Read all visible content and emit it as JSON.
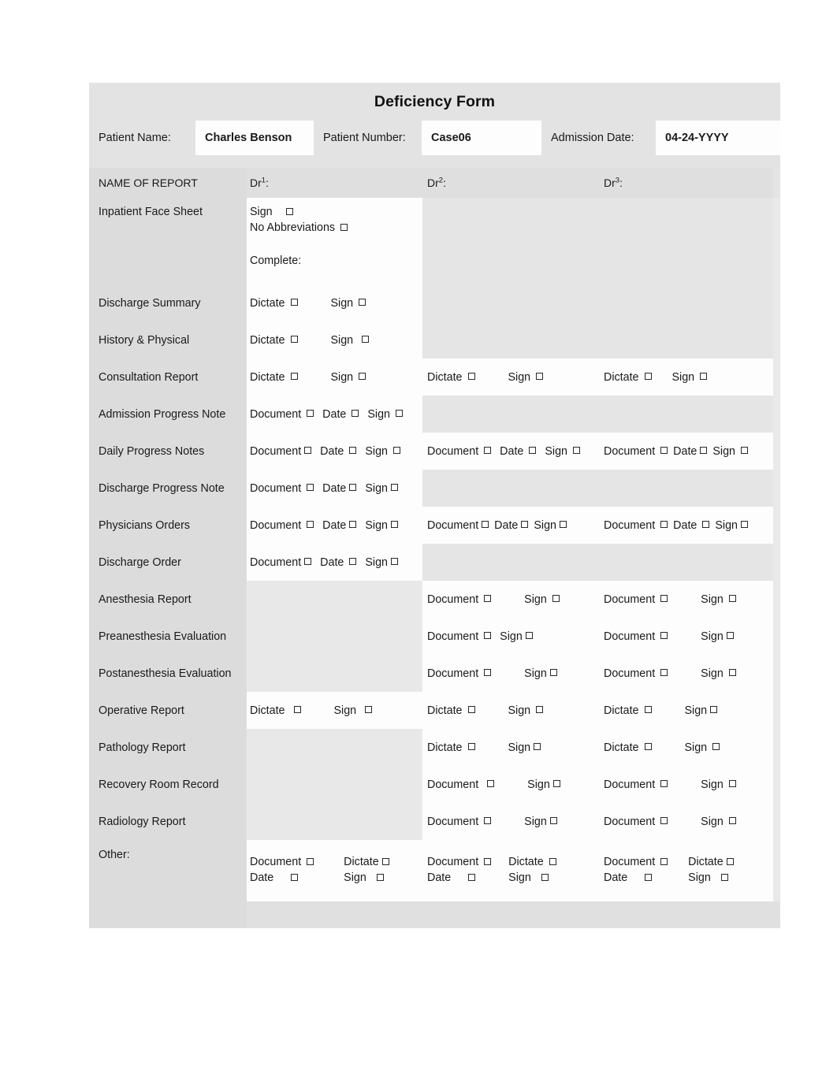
{
  "form": {
    "title": "Deficiency Form",
    "patient": {
      "name_label": "Patient Name:",
      "name_value": "Charles Benson",
      "number_label": "Patient Number:",
      "number_value": "Case06",
      "admission_label": "Admission Date:",
      "admission_value": "04-24-YYYY"
    },
    "columns": {
      "report_header": "NAME OF REPORT",
      "dr1_header": "Dr",
      "dr1_sup": "1",
      "dr1_colon": ":",
      "dr2_header": "Dr",
      "dr2_sup": "2",
      "dr2_colon": ":",
      "dr3_header": "Dr",
      "dr3_sup": "3",
      "dr3_colon": ":"
    },
    "labels": {
      "sign": "Sign",
      "dictate": "Dictate",
      "document": "Document",
      "date": "Date",
      "no_abbreviations": "No Abbreviations",
      "complete": "Complete:"
    },
    "rows": [
      {
        "name": "Inpatient Face Sheet",
        "dr1": [
          "Sign",
          "No Abbreviations",
          "Complete:"
        ],
        "dr2": [],
        "dr3": []
      },
      {
        "name": "Discharge Summary",
        "dr1": [
          "Dictate",
          "Sign"
        ],
        "dr2": [],
        "dr3": []
      },
      {
        "name": "History & Physical",
        "dr1": [
          "Dictate",
          "Sign"
        ],
        "dr2": [],
        "dr3": []
      },
      {
        "name": "Consultation Report",
        "dr1": [
          "Dictate",
          "Sign"
        ],
        "dr2": [
          "Dictate",
          "Sign"
        ],
        "dr3": [
          "Dictate",
          "Sign"
        ]
      },
      {
        "name": "Admission Progress Note",
        "dr1": [
          "Document",
          "Date",
          "Sign"
        ],
        "dr2": [],
        "dr3": []
      },
      {
        "name": "Daily Progress Notes",
        "dr1": [
          "Document",
          "Date",
          "Sign"
        ],
        "dr2": [
          "Document",
          "Date",
          "Sign"
        ],
        "dr3": [
          "Document",
          "Date",
          "Sign"
        ]
      },
      {
        "name": "Discharge Progress Note",
        "dr1": [
          "Document",
          "Date",
          "Sign"
        ],
        "dr2": [],
        "dr3": []
      },
      {
        "name": "Physicians Orders",
        "dr1": [
          "Document",
          "Date",
          "Sign"
        ],
        "dr2": [
          "Document",
          "Date",
          "Sign"
        ],
        "dr3": [
          "Document",
          "Date",
          "Sign"
        ]
      },
      {
        "name": "Discharge Order",
        "dr1": [
          "Document",
          "Date",
          "Sign"
        ],
        "dr2": [],
        "dr3": []
      },
      {
        "name": "Anesthesia Report",
        "dr1": [],
        "dr2": [
          "Document",
          "Sign"
        ],
        "dr3": [
          "Document",
          "Sign"
        ]
      },
      {
        "name": "Preanesthesia Evaluation",
        "dr1": [],
        "dr2": [
          "Document",
          "Sign"
        ],
        "dr3": [
          "Document",
          "Sign"
        ]
      },
      {
        "name": "Postanesthesia Evaluation",
        "dr1": [],
        "dr2": [
          "Document",
          "Sign"
        ],
        "dr3": [
          "Document",
          "Sign"
        ]
      },
      {
        "name": "Operative Report",
        "dr1": [
          "Dictate",
          "Sign"
        ],
        "dr2": [
          "Dictate",
          "Sign"
        ],
        "dr3": [
          "Dictate",
          "Sign"
        ]
      },
      {
        "name": "Pathology Report",
        "dr1": [],
        "dr2": [
          "Dictate",
          "Sign"
        ],
        "dr3": [
          "Dictate",
          "Sign"
        ]
      },
      {
        "name": "Recovery Room Record",
        "dr1": [],
        "dr2": [
          "Document",
          "Sign"
        ],
        "dr3": [
          "Document",
          "Sign"
        ]
      },
      {
        "name": "Radiology Report",
        "dr1": [],
        "dr2": [
          "Document",
          "Sign"
        ],
        "dr3": [
          "Document",
          "Sign"
        ]
      },
      {
        "name": "Other:",
        "dr1": [
          "Document",
          "Dictate",
          "Date",
          "Sign"
        ],
        "dr2": [
          "Document",
          "Dictate",
          "Date",
          "Sign"
        ],
        "dr3": [
          "Document",
          "Dictate",
          "Date",
          "Sign"
        ]
      }
    ]
  },
  "colors": {
    "page_background": "#ffffff",
    "band_background": "#e3e3e3",
    "name_column_background": "#dcdcdc",
    "value_cell_background": "#fdfdfd",
    "empty_cell_background": "#e5e5e5",
    "text": "#1a1a1a",
    "checkbox_border": "#2a2a2a"
  }
}
